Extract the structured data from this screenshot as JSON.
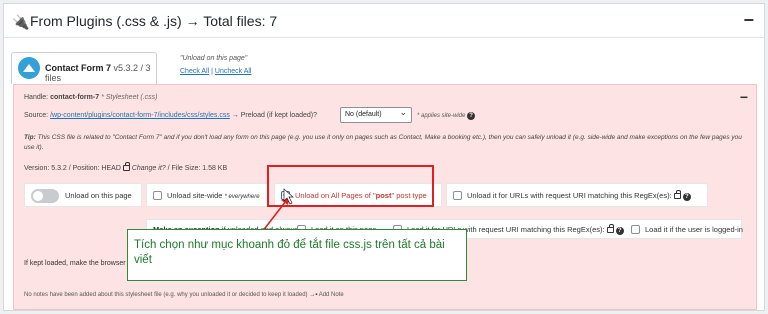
{
  "header": {
    "title": "From Plugins (.css & .js) → Total files: 7",
    "collapse_symbol": "−"
  },
  "tab": {
    "plugin_name": "Contact Form 7",
    "meta": "v5.3.2 / 3 files"
  },
  "unload_note": "\"Unload on this page\"",
  "check_all": "Check All",
  "link_sep": " | ",
  "uncheck_all": "Uncheck All",
  "asset": {
    "handle_label": "Handle:",
    "handle_value": "contact-form-7",
    "handle_type": "* Stylesheet (.css)",
    "source_label": "Source:",
    "source_path": "/wp-content/plugins/contact-form-7/includes/css/styles.css",
    "preload_label": "→ Preload (if kept loaded)?",
    "preload_value": "No (default)",
    "applies": "* applies site-wide",
    "tip_label": "Tip:",
    "tip_text": "This CSS file is related to \"Contact Form 7\" and if you don't load any form on this page (e.g. you use it only on pages such as Contact, Make a booking etc.), then you can safely unload it (e.g. side-wide and make exceptions on the few pages you use it).",
    "version_line": "Version: 5.3.2  /  Position: HEAD",
    "change_it": "Change it?",
    "file_size": "/  File Size: 1.58 KB",
    "collapse_symbol": "−"
  },
  "options": {
    "unload_on_page": "Unload on this page",
    "unload_sitewide": "Unload site-wide",
    "everywhere": "* everywhere",
    "unload_all_post_pre": "Unload on All Pages of \"",
    "post_type": "post",
    "unload_all_post_post": "\" post type",
    "unload_regex": "Unload it for URLs with request URI matching this RegEx(es):"
  },
  "exceptions": {
    "label": "Make an exception",
    "label_rest": "if unloaded and always:",
    "load_on_page": "Load it on this page",
    "load_regex": "Load it for URLs with request URI matching this RegEx(es):",
    "load_logged_in": "Load it if the user is logged-in"
  },
  "kept_loaded": "If kept loaded, make the browser",
  "notes": "No notes have been added about this stylesheet file (e.g. why you unloaded it or decided to keep it loaded)",
  "add_note": "Add Note",
  "annotation": "Tích chọn như mục khoanh đỏ để tắt file css.js trên tất cả bài viết",
  "colors": {
    "annotation_border": "#2d8a3a",
    "highlight": "#e02020",
    "panel_bg": "#fde3e3",
    "link": "#2271b1"
  },
  "icons": [
    "plug-icon",
    "minus-icon",
    "help-icon",
    "lock-icon",
    "note-icon",
    "cursor-icon"
  ]
}
